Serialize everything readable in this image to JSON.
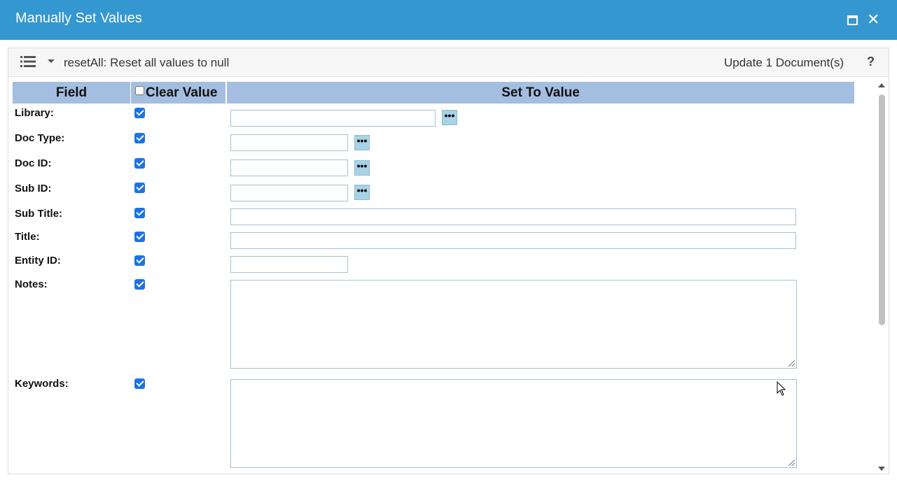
{
  "window": {
    "title": "Manually Set Values",
    "maximize_icon": "maximize-icon",
    "close_icon": "close-icon",
    "close_glyph": "✕"
  },
  "toolbar": {
    "menu_icon": "list-icon",
    "dropdown_icon": "caret-down-icon",
    "action_label": "resetAll: Reset all values to null",
    "update_label": "Update 1 Document(s)",
    "help_label": "?"
  },
  "table": {
    "headers": {
      "field": "Field",
      "clear_value": "Clear Value",
      "set_to_value": "Set To Value"
    },
    "clear_all_checked": false,
    "rows": [
      {
        "label": "Library:",
        "clear": true,
        "value": "",
        "has_lookup": true
      },
      {
        "label": "Doc Type:",
        "clear": true,
        "value": "",
        "has_lookup": true
      },
      {
        "label": "Doc ID:",
        "clear": true,
        "value": "",
        "has_lookup": true
      },
      {
        "label": "Sub ID:",
        "clear": true,
        "value": "",
        "has_lookup": true
      },
      {
        "label": "Sub Title:",
        "clear": true,
        "value": "",
        "has_lookup": false
      },
      {
        "label": "Title:",
        "clear": true,
        "value": "",
        "has_lookup": false
      },
      {
        "label": "Entity ID:",
        "clear": true,
        "value": "",
        "has_lookup": false
      },
      {
        "label": "Notes:",
        "clear": true,
        "value": "",
        "has_lookup": false
      },
      {
        "label": "Keywords:",
        "clear": true,
        "value": "",
        "has_lookup": false
      }
    ],
    "lookup_glyph": "•••"
  },
  "colors": {
    "titlebar": "#3497d0",
    "header": "#a3bee0",
    "checkbox": "#1a73e8",
    "lookup_button": "#a8d3e6"
  }
}
